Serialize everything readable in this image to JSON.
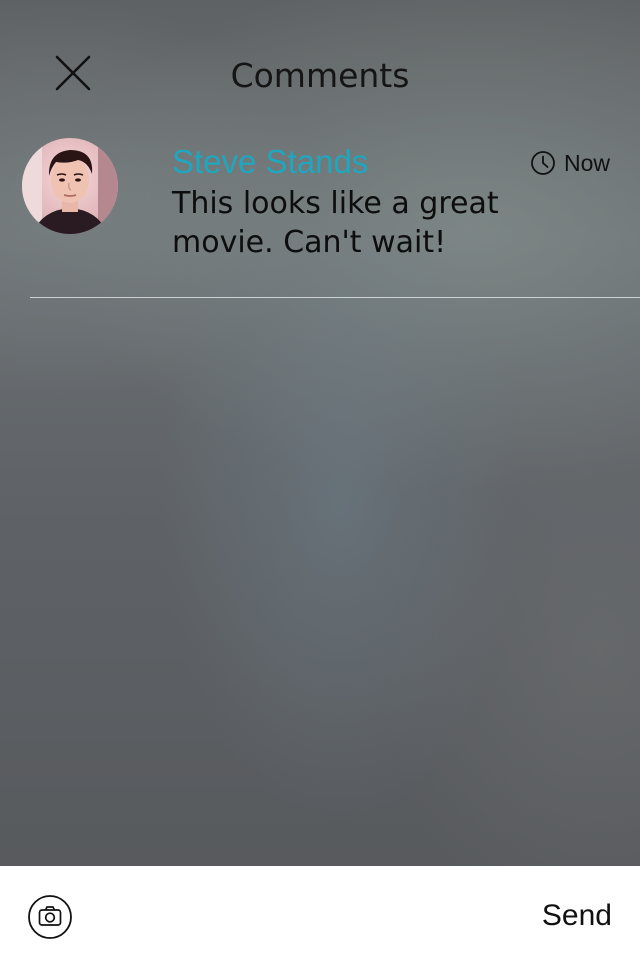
{
  "header": {
    "title": "Comments",
    "close_icon": "close-icon"
  },
  "comments": [
    {
      "author": "Steve Stands",
      "time": "Now",
      "text": "This looks like a great movie. Can't wait!",
      "avatar_icon": "avatar"
    }
  ],
  "composer": {
    "camera_icon": "camera-icon",
    "send_label": "Send"
  },
  "colors": {
    "accent": "#1ea7bf",
    "bottom_bar": "#ffffff"
  }
}
